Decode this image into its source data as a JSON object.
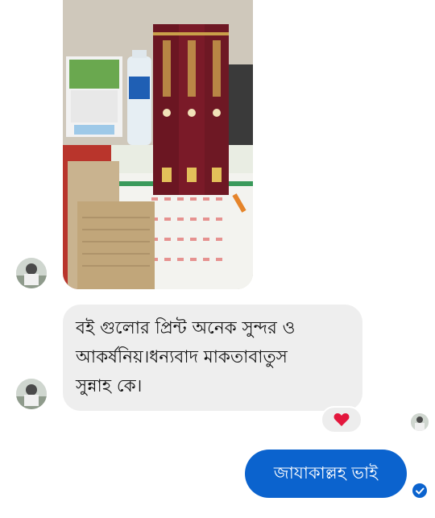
{
  "conversation": {
    "incoming_photo": {
      "alt": ""
    },
    "incoming_message": {
      "lines": [
        "বই গুলোর প্রিন্ট অনেক সুন্দর ও",
        "আকর্ষনিয়।ধন্যবাদ মাকতাবাতুস",
        "সুন্নাহ কে।"
      ],
      "reaction": "heart-icon"
    },
    "outgoing_message": {
      "text": "জাযাকাল্লহ ভাই",
      "status_icon": "delivered-check-icon"
    },
    "colors": {
      "incoming_bubble": "#eeeeee",
      "outgoing_bubble": "#0b63ce",
      "reaction_heart": "#e3173d"
    }
  }
}
